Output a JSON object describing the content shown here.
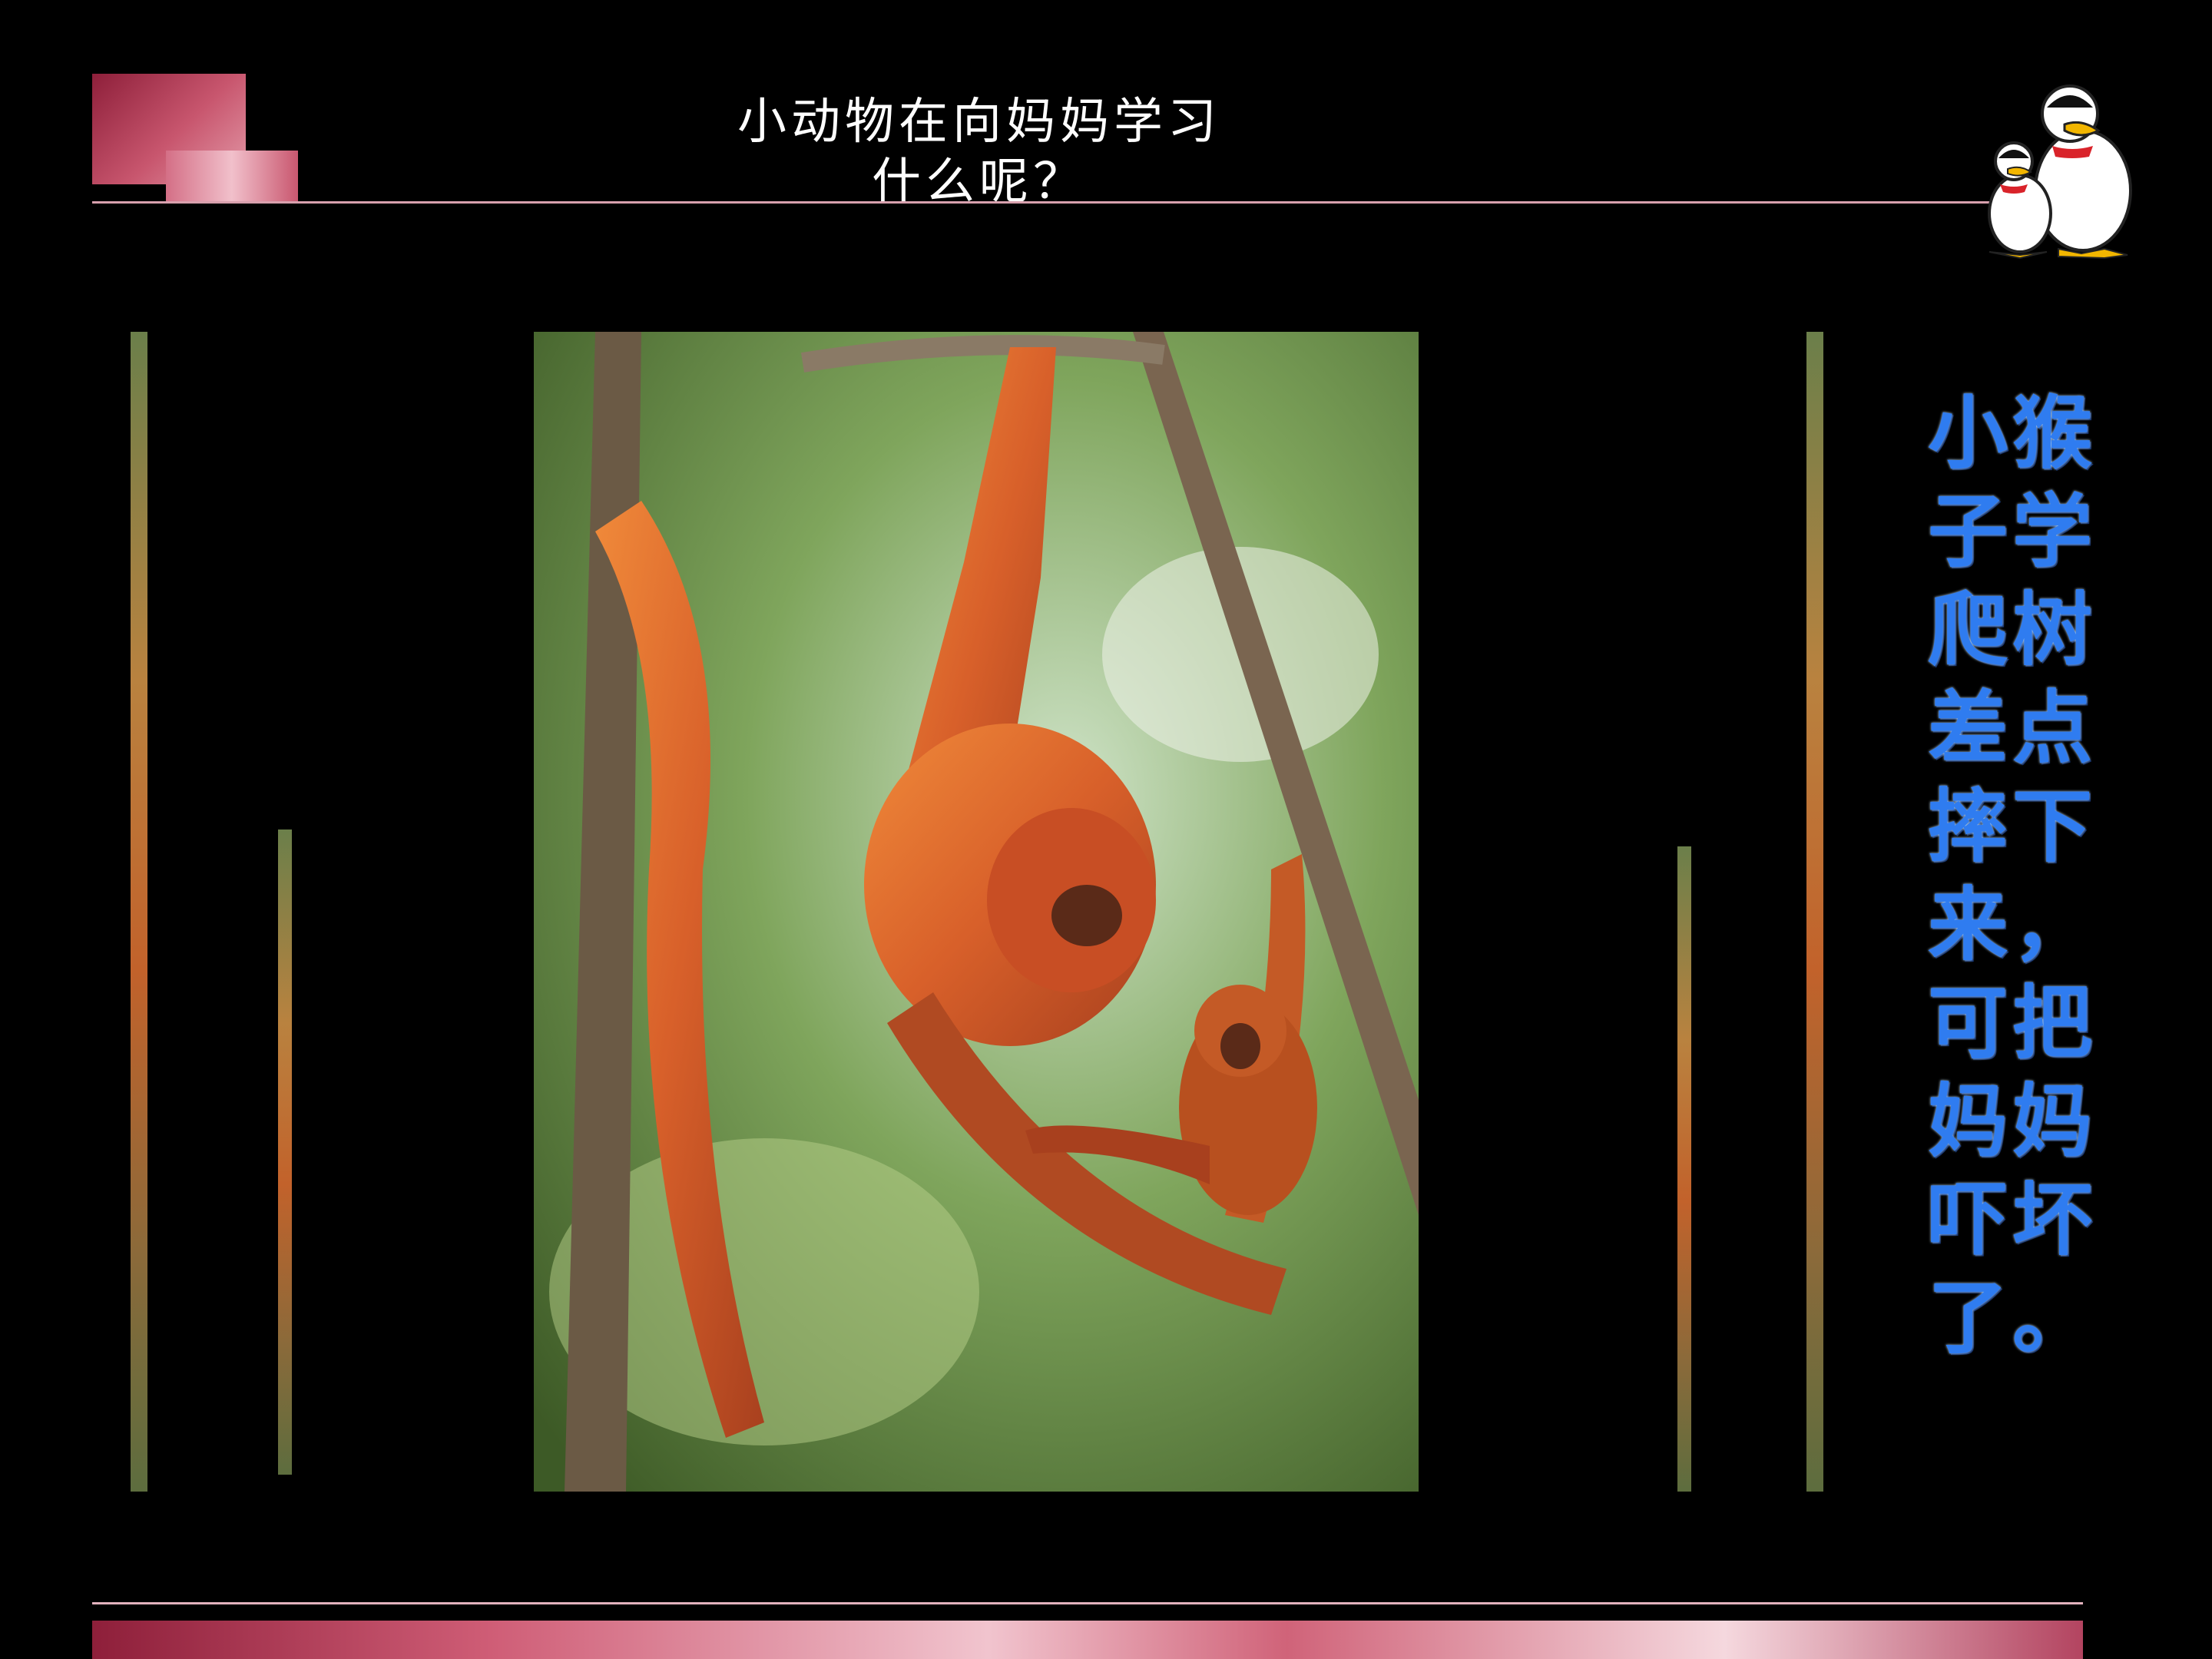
{
  "slide": {
    "title": "小动物在向妈妈学习\n什么呢？",
    "caption": "小猴子学爬树差点摔下来，可把妈妈吓坏了。"
  },
  "photo": {
    "subject": "orangutan-mother-and-baby-in-tree"
  },
  "icons": {
    "mascot": "penguin-pair-mascot-icon"
  },
  "colors": {
    "background": "#000000",
    "caption_text": "#2f7cf0",
    "accent_bar": "#c8566e"
  }
}
